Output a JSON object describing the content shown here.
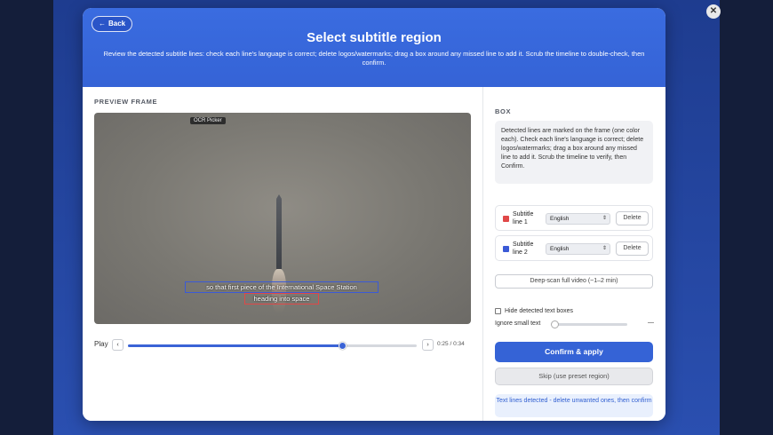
{
  "header": {
    "back_label": "Back",
    "title": "Select subtitle region",
    "subtitle": "Review the detected subtitle lines: check each line's language is correct; delete logos/watermarks; drag a box around any missed line to add it. Scrub the timeline to double-check, then confirm."
  },
  "preview": {
    "section_label": "PREVIEW FRAME",
    "ocr_tag": "OCR Picker",
    "subtitle_line_1": "so that first piece of the International Space Station",
    "subtitle_line_2": "heading into space"
  },
  "timeline": {
    "play_label": "Play",
    "prev_label": "‹",
    "next_label": "›",
    "progress_fraction": 0.74,
    "time_label": "0:25 / 0:34"
  },
  "box_panel": {
    "section_label": "BOX",
    "info_text": "Detected lines are marked on the frame (one color each). Check each line's language is correct; delete logos/watermarks; drag a box around any missed line to add it. Scrub the timeline to verify, then Confirm.",
    "lines": [
      {
        "name": "Subtitle line 1",
        "color": "#e04848",
        "language": "English",
        "delete_label": "Delete"
      },
      {
        "name": "Subtitle line 2",
        "color": "#3b5ad6",
        "language": "English",
        "delete_label": "Delete"
      }
    ],
    "deep_scan_label": "Deep-scan full video (~1–2 min)",
    "hide_boxes_label": "Hide detected text boxes",
    "hide_boxes_checked": false,
    "ignore_small_label": "Ignore small text",
    "ignore_small_value_label": "—",
    "ignore_small_level": 0,
    "confirm_label": "Confirm & apply",
    "skip_label": "Skip (use preset region)",
    "notice_text": "Text lines detected - delete unwanted ones, then confirm"
  },
  "colors": {
    "accent": "#3563d6",
    "line1": "#e04848",
    "line2": "#3b5ad6"
  },
  "icons": {
    "back": "arrow-left-icon",
    "close": "close-icon",
    "select": "chevron-updown-icon"
  }
}
